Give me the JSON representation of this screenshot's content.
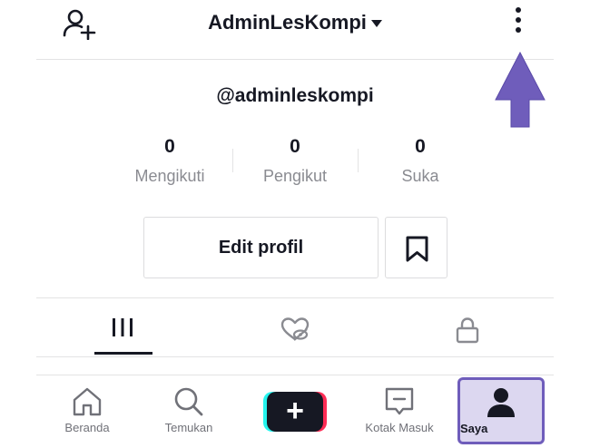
{
  "header": {
    "username": "AdminLesKompi",
    "add_user_icon": "add-user-icon",
    "more_icon": "vertical-dots-icon"
  },
  "profile": {
    "handle": "@adminleskompi",
    "stats": [
      {
        "value": "0",
        "label": "Mengikuti"
      },
      {
        "value": "0",
        "label": "Pengikut"
      },
      {
        "value": "0",
        "label": "Suka"
      }
    ],
    "edit_label": "Edit profil",
    "bookmark_icon": "bookmark-icon"
  },
  "tabs": [
    {
      "icon": "grid-icon",
      "active": true
    },
    {
      "icon": "liked-hidden-icon",
      "active": false
    },
    {
      "icon": "lock-icon",
      "active": false
    }
  ],
  "bottom_nav": [
    {
      "label": "Beranda",
      "icon": "home-icon"
    },
    {
      "label": "Temukan",
      "icon": "search-icon"
    },
    {
      "label": "",
      "icon": "plus-icon"
    },
    {
      "label": "Kotak Masuk",
      "icon": "inbox-icon"
    },
    {
      "label": "Saya",
      "icon": "profile-icon"
    }
  ],
  "plus_symbol": "+",
  "colors": {
    "annotation_arrow": "#6f5dbb",
    "highlight_bg": "#dcd7f0",
    "cyan": "#25f4ee",
    "red": "#fe2c55",
    "text": "#161823"
  }
}
